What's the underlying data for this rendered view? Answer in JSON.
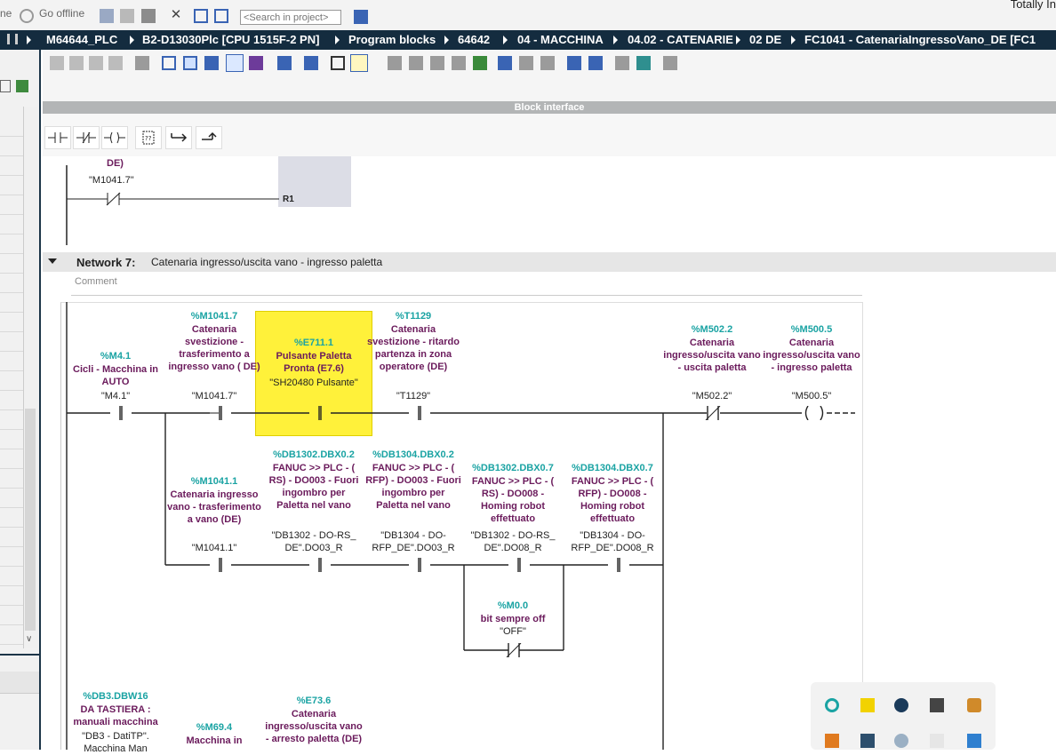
{
  "topbar": {
    "partial_left": "ne",
    "go_offline": "Go offline",
    "search_placeholder": "<Search in project>",
    "brand_partial": "Totally In"
  },
  "breadcrumb": [
    "M64644_PLC",
    "B2-D13030Plc [CPU 1515F-2 PN]",
    "Program blocks",
    "64642",
    "04 - MACCHINA",
    "04.02 - CATENARIE",
    "02 DE",
    "FC1041 - CatenariaIngressoVano_DE [FC1"
  ],
  "block_interface": "Block interface",
  "prev_network": {
    "desc_tail": "DE)",
    "tag": "\"M1041.7\"",
    "coil_label": "R1"
  },
  "network7": {
    "title": "Network 7:",
    "description": "Catenaria ingresso/uscita vano - ingresso paletta",
    "comment_label": "Comment",
    "row1": [
      {
        "addr": "%M4.1",
        "desc": "Cicli - Macchina in AUTO",
        "tag": "\"M4.1\""
      },
      {
        "addr": "%M1041.7",
        "desc": "Catenaria svestizione - trasferimento a ingresso vano ( DE)",
        "tag": "\"M1041.7\""
      },
      {
        "addr": "%E711.1",
        "desc": "Pulsante Paletta Pronta (E7.6)",
        "tag": "\"SH20480 Pulsante\""
      },
      {
        "addr": "%T1129",
        "desc": "Catenaria svestizione - ritardo partenza in zona operatore (DE)",
        "tag": "\"T1129\""
      },
      {
        "addr": "%M502.2",
        "desc": "Catenaria ingresso/uscita vano - uscita paletta",
        "tag": "\"M502.2\""
      },
      {
        "addr": "%M500.5",
        "desc": "Catenaria ingresso/uscita vano - ingresso paletta",
        "tag": "\"M500.5\""
      }
    ],
    "row2": [
      {
        "addr": "%M1041.1",
        "desc": "Catenaria ingresso vano - trasferimento a vano (DE)",
        "tag": "\"M1041.1\""
      },
      {
        "addr": "%DB1302.DBX0.2",
        "desc": "FANUC >> PLC - ( RS) - DO003 - Fuori ingombro per Paletta nel vano",
        "tag": "\"DB1302 - DO-RS_ DE\".DO03_R"
      },
      {
        "addr": "%DB1304.DBX0.2",
        "desc": "FANUC >> PLC - ( RFP) - DO003 - Fuori ingombro per Paletta nel vano",
        "tag": "\"DB1304 - DO- RFP_DE\".DO03_R"
      },
      {
        "addr": "%DB1302.DBX0.7",
        "desc": "FANUC >> PLC - ( RS) - DO008 - Homing robot effettuato",
        "tag": "\"DB1302 - DO-RS_ DE\".DO08_R"
      },
      {
        "addr": "%DB1304.DBX0.7",
        "desc": "FANUC >> PLC - ( RFP) - DO008 - Homing robot effettuato",
        "tag": "\"DB1304 - DO- RFP_DE\".DO08_R"
      }
    ],
    "branch": {
      "addr": "%M0.0",
      "desc": "bit sempre off",
      "tag": "\"OFF\""
    },
    "row3": [
      {
        "addr": "%DB3.DBW16",
        "desc": "DA TASTIERA : manuali macchina",
        "tag": "\"DB3 - DatiTP\". Macchina Man"
      },
      {
        "addr": "%M69.4",
        "desc": "Macchina in",
        "tag": ""
      },
      {
        "addr": "%E73.6",
        "desc": "Catenaria ingresso/uscita vano - arresto paletta (DE)",
        "tag": ""
      }
    ]
  },
  "colors": {
    "address": "#1aa3a3",
    "description": "#6b1b5c",
    "highlight": "#fff13a",
    "breadcrumb_bg": "#142c3f"
  }
}
